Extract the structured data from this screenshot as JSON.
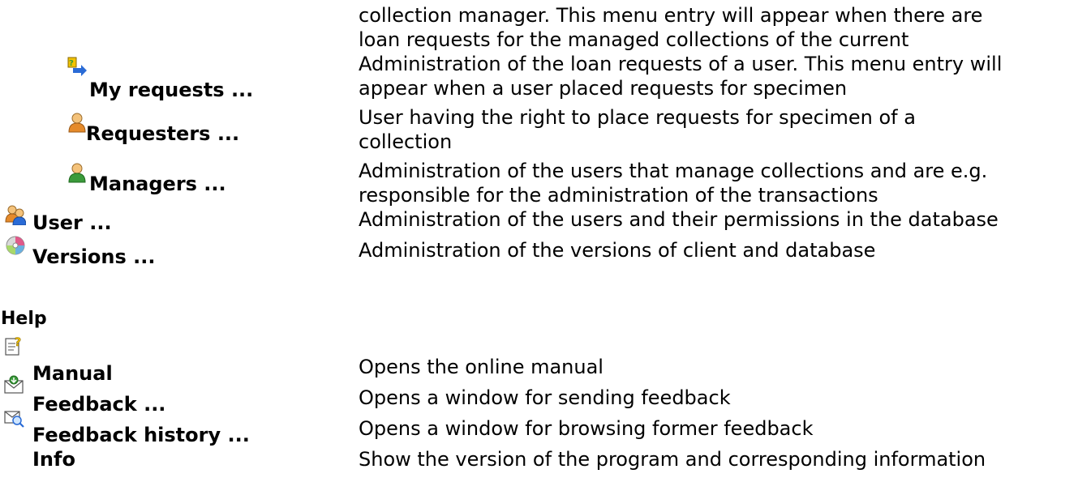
{
  "top_description": {
    "line1": "collection manager. This menu entry will appear when there are",
    "line2": "loan requests for the managed collections of the current"
  },
  "rows": [
    {
      "label": "My requests ...",
      "icon": "requests-icon",
      "description": [
        "Administration of the loan requests of a user. This menu entry will",
        "appear when a user placed requests for specimen"
      ]
    },
    {
      "label": "Requesters ...",
      "icon": "requester-user-icon",
      "description": [
        "User having the right to place requests for specimen of a",
        "collection"
      ]
    },
    {
      "label": "Managers ...",
      "icon": "manager-user-icon",
      "description": [
        "Administration of the users that manage collections and are e.g.",
        "responsible for the administration of the transactions"
      ]
    },
    {
      "label": "User ...",
      "icon": "users-icon",
      "description": [
        "Administration of the users and their permissions in the database"
      ]
    },
    {
      "label": "Versions ...",
      "icon": "versions-disc-icon",
      "description": [
        "Administration of the versions of client and database"
      ]
    }
  ],
  "help": {
    "heading": "Help",
    "items": [
      {
        "label": "Manual",
        "icon": "manual-icon",
        "description": "Opens the online manual"
      },
      {
        "label": "Feedback ...",
        "icon": "feedback-icon",
        "description": "Opens a window for sending feedback"
      },
      {
        "label": "Feedback history ...",
        "icon": "feedback-history-icon",
        "description": "Opens a window for browsing former feedback"
      },
      {
        "label": "Info",
        "icon": "",
        "description": "Show the version of the program and corresponding information"
      }
    ]
  },
  "colors": {
    "text": "#000000",
    "background": "#ffffff",
    "accent_blue": "#2a6bd6",
    "accent_green": "#3a9a3a",
    "accent_yellow": "#f2c200"
  }
}
